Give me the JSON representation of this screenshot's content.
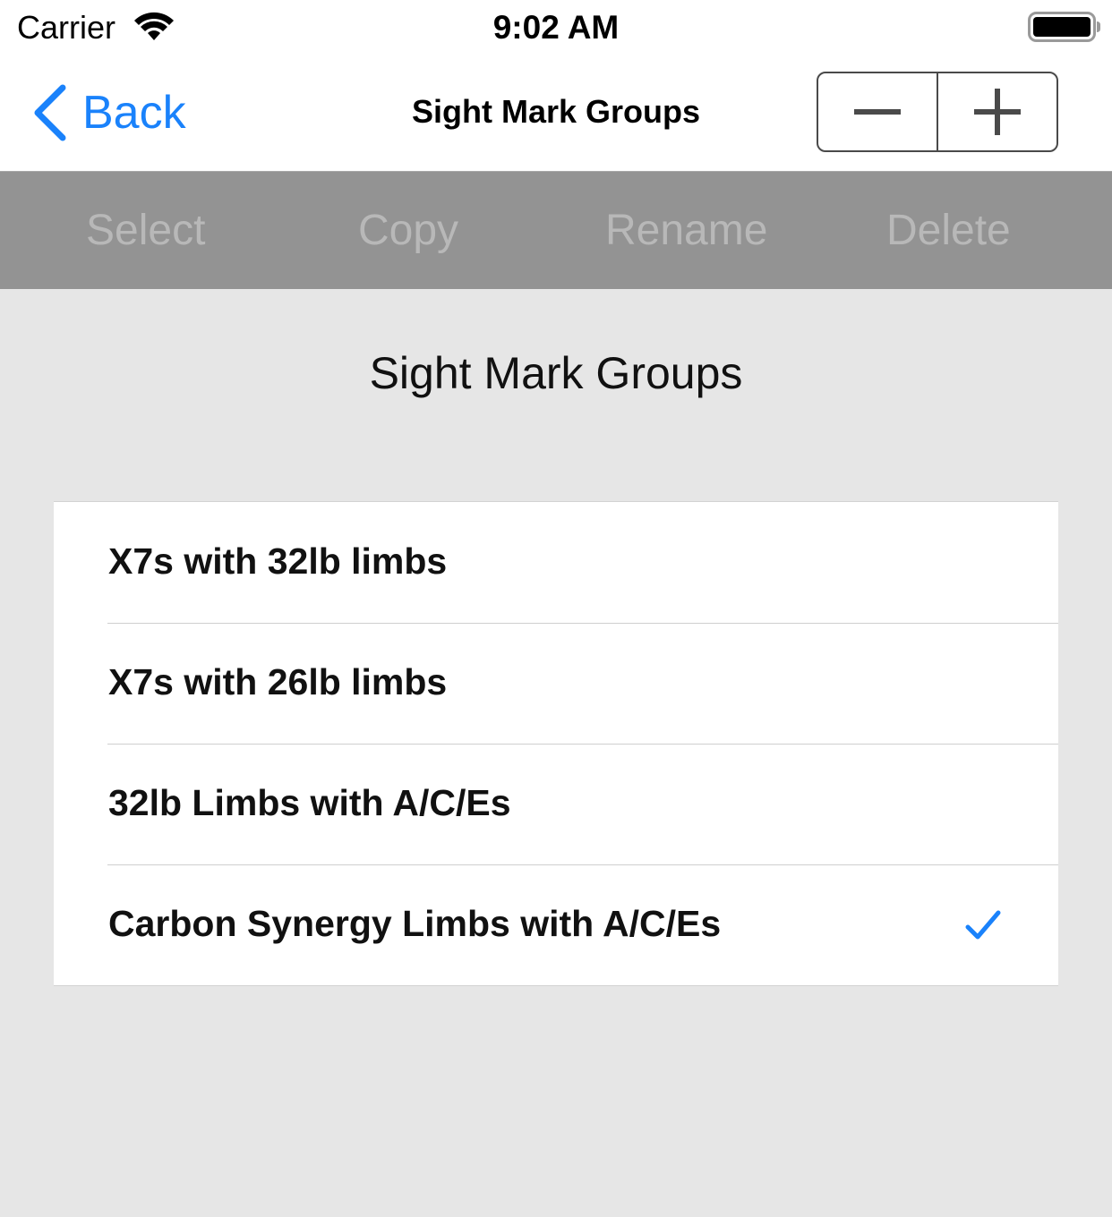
{
  "status_bar": {
    "carrier": "Carrier",
    "time": "9:02 AM",
    "icons": [
      "wifi-icon",
      "battery-icon"
    ]
  },
  "nav_bar": {
    "back_label": "Back",
    "title": "Sight Mark Groups",
    "stepper": {
      "decrement_icon": "minus-icon",
      "increment_icon": "plus-icon"
    }
  },
  "toolbar": {
    "items": [
      "Select",
      "Copy",
      "Rename",
      "Delete"
    ]
  },
  "content": {
    "title": "Sight Mark Groups",
    "groups": [
      {
        "label": "X7s with 32lb limbs",
        "selected": false
      },
      {
        "label": "X7s with 26lb limbs",
        "selected": false
      },
      {
        "label": "32lb Limbs with A/C/Es",
        "selected": false
      },
      {
        "label": "Carbon Synergy Limbs with A/C/Es",
        "selected": true
      }
    ]
  },
  "colors": {
    "accent": "#1a82fb",
    "toolbar_bg": "#939393",
    "toolbar_text_disabled": "#b8b8b8",
    "background": "#e6e6e6"
  }
}
